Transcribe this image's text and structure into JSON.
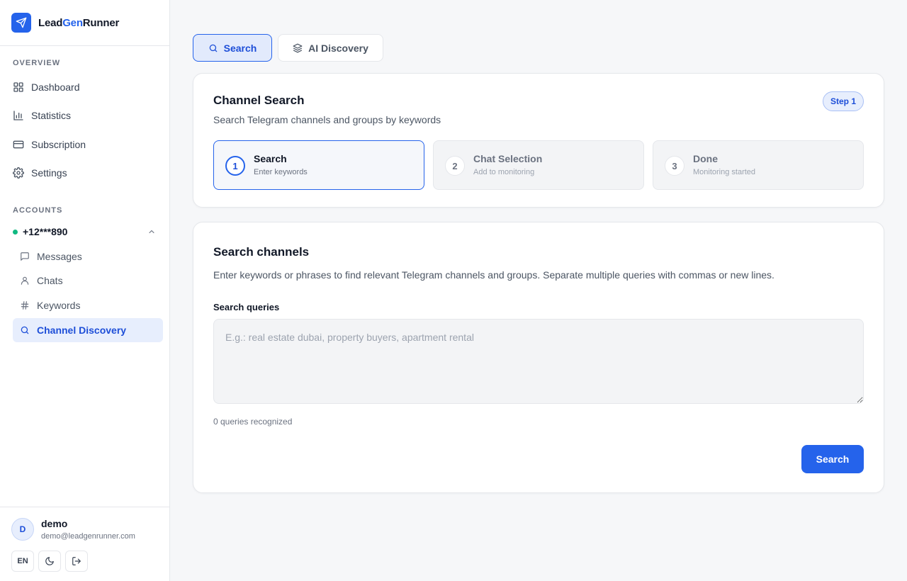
{
  "brand": {
    "part1": "Lead",
    "part2": "Gen",
    "part3": "Runner",
    "accent_color": "#2563eb",
    "logo_icon": "send-icon"
  },
  "sidebar": {
    "overview_label": "OVERVIEW",
    "nav": [
      {
        "label": "Dashboard",
        "icon": "grid-icon"
      },
      {
        "label": "Statistics",
        "icon": "bar-chart-icon"
      },
      {
        "label": "Subscription",
        "icon": "credit-card-icon"
      },
      {
        "label": "Settings",
        "icon": "gear-icon"
      }
    ],
    "accounts_label": "ACCOUNTS",
    "account": {
      "phone": "+12***890",
      "status_color": "#10b981",
      "expanded": true
    },
    "sub_nav": [
      {
        "label": "Messages",
        "icon": "message-icon"
      },
      {
        "label": "Chats",
        "icon": "user-icon"
      },
      {
        "label": "Keywords",
        "icon": "hash-icon"
      },
      {
        "label": "Channel Discovery",
        "icon": "search-icon",
        "active": true
      }
    ]
  },
  "user": {
    "initial": "D",
    "name": "demo",
    "email": "demo@leadgenrunner.com",
    "lang": "EN"
  },
  "tabs": [
    {
      "label": "Search",
      "icon": "search-icon",
      "active": true
    },
    {
      "label": "AI Discovery",
      "icon": "layers-icon",
      "active": false
    }
  ],
  "channel_search": {
    "title": "Channel Search",
    "subtitle": "Search Telegram channels and groups by keywords",
    "badge": "Step 1",
    "steps": [
      {
        "num": "1",
        "label": "Search",
        "desc": "Enter keywords",
        "active": true
      },
      {
        "num": "2",
        "label": "Chat Selection",
        "desc": "Add to monitoring",
        "active": false
      },
      {
        "num": "3",
        "label": "Done",
        "desc": "Monitoring started",
        "active": false
      }
    ]
  },
  "search_channels": {
    "title": "Search channels",
    "description": "Enter keywords or phrases to find relevant Telegram channels and groups. Separate multiple queries with commas or new lines.",
    "field_label": "Search queries",
    "placeholder": "E.g.: real estate dubai, property buyers, apartment rental",
    "value": "",
    "count_text": "0 queries recognized",
    "button_label": "Search"
  }
}
